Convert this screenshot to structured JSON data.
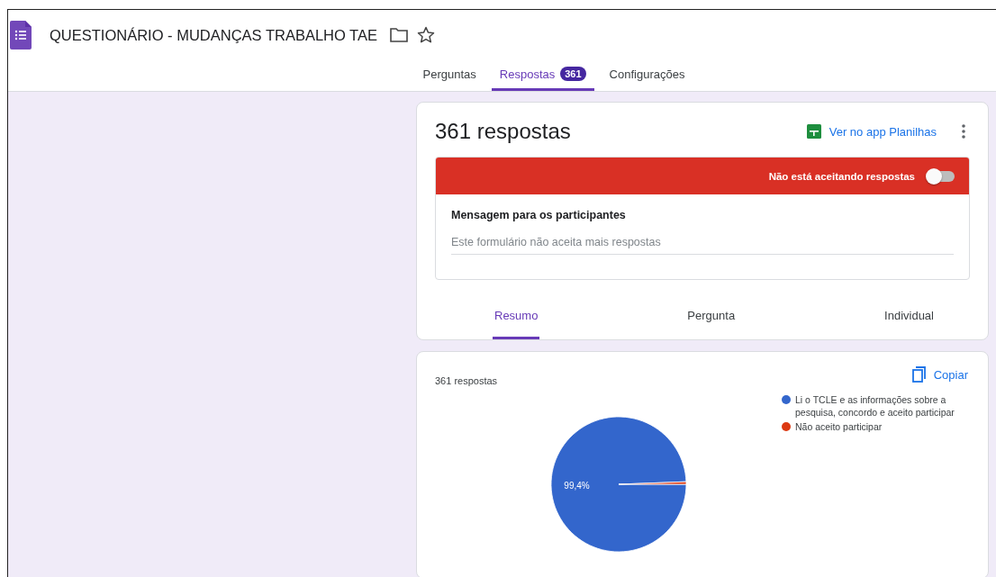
{
  "header": {
    "title": "QUESTIONÁRIO - MUDANÇAS TRABALHO TAE"
  },
  "tabs": [
    {
      "label": "Perguntas",
      "selected": false
    },
    {
      "label": "Respostas",
      "selected": true,
      "badge": "361"
    },
    {
      "label": "Configurações",
      "selected": false
    }
  ],
  "summary_card": {
    "title": "361 respostas",
    "sheets_link": "Ver no app Planilhas",
    "accepting_label": "Não está aceitando respostas",
    "accepting": false,
    "message_label": "Mensagem para os participantes",
    "message_field": {
      "placeholder": "Este formulário não aceita mais respostas"
    },
    "view_tabs": [
      {
        "label": "Resumo",
        "selected": true
      },
      {
        "label": "Pergunta",
        "selected": false
      },
      {
        "label": "Individual",
        "selected": false
      }
    ]
  },
  "question_card": {
    "count": "361 respostas",
    "copy_button": "Copiar",
    "chart_data": {
      "type": "pie",
      "categories": [
        "Li o TCLE e as informações sobre a pesquisa, concordo e aceito participar",
        "Não aceito participar"
      ],
      "colors": [
        "#3366cc",
        "#dc3912"
      ],
      "legend": "right",
      "series": [
        {
          "values": [
            99.4,
            0.6
          ]
        }
      ],
      "value_labels": [
        "99,4%",
        null
      ]
    }
  }
}
